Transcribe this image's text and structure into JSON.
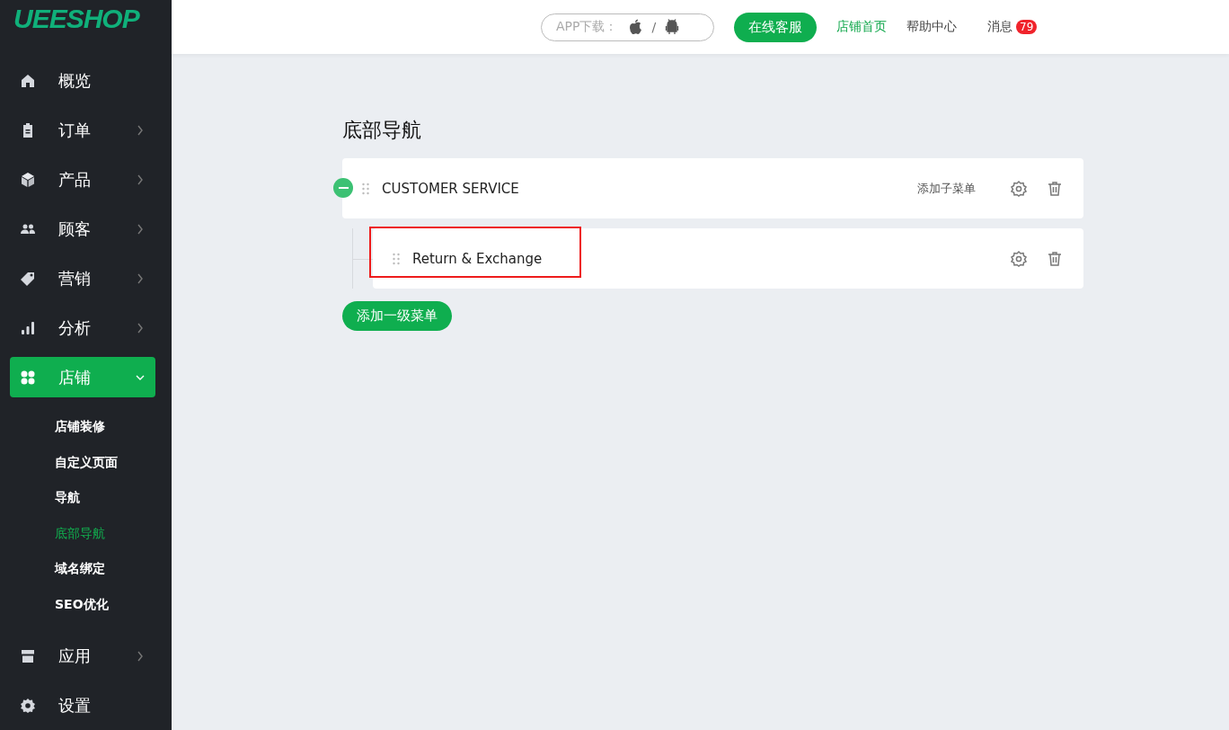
{
  "logo": "UEESHOP",
  "sidebar": {
    "items": [
      {
        "label": "概览",
        "expandable": false,
        "selected": false
      },
      {
        "label": "订单",
        "expandable": true,
        "expanded": false,
        "selected": false
      },
      {
        "label": "产品",
        "expandable": true,
        "expanded": false,
        "selected": false
      },
      {
        "label": "顾客",
        "expandable": true,
        "expanded": false,
        "selected": false
      },
      {
        "label": "营销",
        "expandable": true,
        "expanded": false,
        "selected": false
      },
      {
        "label": "分析",
        "expandable": true,
        "expanded": false,
        "selected": false
      },
      {
        "label": "店铺",
        "expandable": true,
        "expanded": true,
        "selected": true,
        "children": [
          {
            "label": "店铺装修",
            "selected": false
          },
          {
            "label": "自定义页面",
            "selected": false
          },
          {
            "label": "导航",
            "selected": false
          },
          {
            "label": "底部导航",
            "selected": true
          },
          {
            "label": "域名绑定",
            "selected": false
          },
          {
            "label": "SEO优化",
            "selected": false
          }
        ]
      },
      {
        "label": "应用",
        "expandable": true,
        "expanded": false,
        "selected": false
      },
      {
        "label": "设置",
        "expandable": false,
        "selected": false
      }
    ]
  },
  "header": {
    "app_download": {
      "label": "APP下载：",
      "separator": "/"
    },
    "support_button": "在线客服",
    "links": [
      {
        "label": "店铺首页",
        "selected": true
      },
      {
        "label": "帮助中心",
        "selected": false
      }
    ],
    "messages": {
      "label": "消息",
      "count": "79"
    }
  },
  "page": {
    "title": "底部导航",
    "menus": [
      {
        "label": "CUSTOMER SERVICE",
        "add_child": "添加子菜单",
        "expanded": true,
        "children": [
          {
            "label": "Return & Exchange",
            "highlighted": true
          }
        ]
      }
    ],
    "add_button": "添加一级菜单"
  }
}
